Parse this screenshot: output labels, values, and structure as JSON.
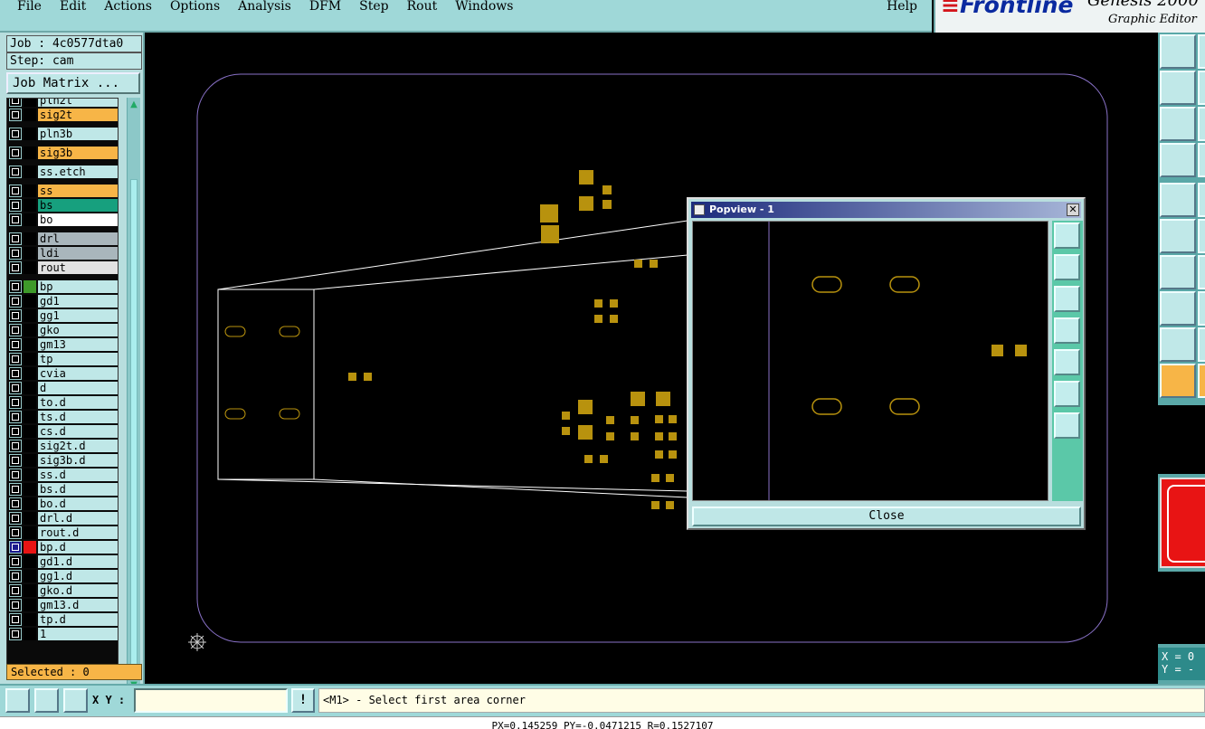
{
  "menu": [
    "File",
    "Edit",
    "Actions",
    "Options",
    "Analysis",
    "DFM",
    "Step",
    "Rout",
    "Windows"
  ],
  "help_label": "Help",
  "brand": {
    "logo": "Frontline",
    "product": "Genesis 2000",
    "subtitle": "Graphic Editor"
  },
  "job": {
    "job_label": "Job : 4c0577dta0",
    "step_label": "Step: cam",
    "matrix_button": "Job Matrix ..."
  },
  "layers": [
    {
      "name": "pln2t",
      "color": "#bfe7e7",
      "swatch": "#000000"
    },
    {
      "name": "sig2t",
      "color": "#f7b547",
      "swatch": "#000000"
    },
    {
      "name": "pln3b",
      "color": "#bfe7e7",
      "swatch": "#000000"
    },
    {
      "name": "sig3b",
      "color": "#f7b547",
      "swatch": "#000000"
    },
    {
      "name": "ss.etch",
      "color": "#bfe7e7",
      "swatch": "#000000"
    },
    {
      "name": "ss",
      "color": "#f7b547",
      "swatch": "#000000"
    },
    {
      "name": "bs",
      "color": "#17a07e",
      "swatch": "#000000"
    },
    {
      "name": "bo",
      "color": "#ffffff",
      "swatch": "#000000"
    },
    {
      "name": "drl",
      "color": "#a9b6bc",
      "swatch": "#000000"
    },
    {
      "name": "ldi",
      "color": "#a9b6bc",
      "swatch": "#000000"
    },
    {
      "name": "rout",
      "color": "#e2e2e2",
      "swatch": "#000000"
    },
    {
      "name": "bp",
      "color": "#bfe7e7",
      "swatch": "#3e9a2a"
    },
    {
      "name": "gd1",
      "color": "#bfe7e7",
      "swatch": "#000000"
    },
    {
      "name": "gg1",
      "color": "#bfe7e7",
      "swatch": "#000000"
    },
    {
      "name": "gko",
      "color": "#bfe7e7",
      "swatch": "#000000"
    },
    {
      "name": "gm13",
      "color": "#bfe7e7",
      "swatch": "#000000"
    },
    {
      "name": "tp",
      "color": "#bfe7e7",
      "swatch": "#000000"
    },
    {
      "name": "cvia",
      "color": "#bfe7e7",
      "swatch": "#000000"
    },
    {
      "name": "d",
      "color": "#bfe7e7",
      "swatch": "#000000"
    },
    {
      "name": "to.d",
      "color": "#bfe7e7",
      "swatch": "#000000"
    },
    {
      "name": "ts.d",
      "color": "#bfe7e7",
      "swatch": "#000000"
    },
    {
      "name": "cs.d",
      "color": "#bfe7e7",
      "swatch": "#000000"
    },
    {
      "name": "sig2t.d",
      "color": "#bfe7e7",
      "swatch": "#000000"
    },
    {
      "name": "sig3b.d",
      "color": "#bfe7e7",
      "swatch": "#000000"
    },
    {
      "name": "ss.d",
      "color": "#bfe7e7",
      "swatch": "#000000"
    },
    {
      "name": "bs.d",
      "color": "#bfe7e7",
      "swatch": "#000000"
    },
    {
      "name": "bo.d",
      "color": "#bfe7e7",
      "swatch": "#000000"
    },
    {
      "name": "drl.d",
      "color": "#bfe7e7",
      "swatch": "#000000"
    },
    {
      "name": "rout.d",
      "color": "#bfe7e7",
      "swatch": "#000000"
    },
    {
      "name": "bp.d",
      "color": "#bfe7e7",
      "swatch": "#e81414"
    },
    {
      "name": "gd1.d",
      "color": "#bfe7e7",
      "swatch": "#000000"
    },
    {
      "name": "gg1.d",
      "color": "#bfe7e7",
      "swatch": "#000000"
    },
    {
      "name": "gko.d",
      "color": "#bfe7e7",
      "swatch": "#000000"
    },
    {
      "name": "gm13.d",
      "color": "#bfe7e7",
      "swatch": "#000000"
    },
    {
      "name": "tp.d",
      "color": "#bfe7e7",
      "swatch": "#000000"
    },
    {
      "name": "1",
      "color": "#bfe7e7",
      "swatch": "#000000"
    }
  ],
  "selected_label": "Selected : 0",
  "popview": {
    "title": "Popview - 1",
    "close_label": "Close"
  },
  "bottom": {
    "xy_label": "X Y :",
    "xy_value": "",
    "info_label": "!",
    "prompt": "<M1> - Select first area corner"
  },
  "readout": {
    "x": "X = 0",
    "y": "Y = -"
  },
  "status": "PX=0.145259 PY=-0.0471215 R=0.1527107",
  "colors": {
    "pad": "#b8920e",
    "outline": "#8a72c9",
    "panel": "#9fd8d8",
    "highlight": "#f7b547"
  }
}
